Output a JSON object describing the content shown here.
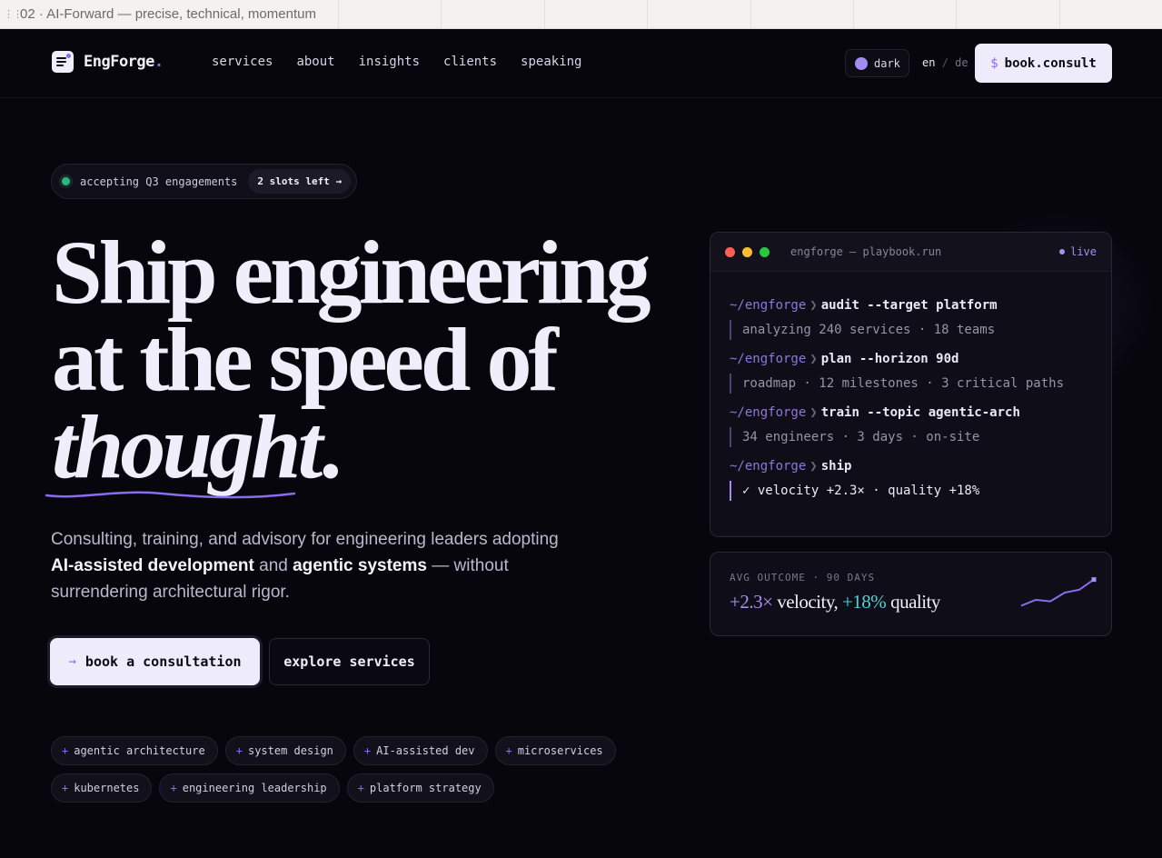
{
  "frame_label": "02 · AI-Forward — precise, technical, momentum",
  "brand": {
    "name": "EngForge",
    "accent_char": ".",
    "accent_color": "#8b6cf0"
  },
  "nav": {
    "links": [
      "services",
      "about",
      "insights",
      "clients",
      "speaking"
    ],
    "theme_label": "dark",
    "lang_active": "en",
    "lang_sep": "/",
    "lang_other": "de",
    "cta_sign": "$",
    "cta_label": "book.consult"
  },
  "hero": {
    "status_text": "accepting Q3 engagements",
    "slots_label": "2 slots left →",
    "headline_1": "Ship engineering",
    "headline_2": "at the speed of",
    "headline_3": "thought",
    "headline_period": ".",
    "sub_1": "Consulting, training, and advisory for engineering leaders adopting ",
    "sub_b1": "AI-assisted development",
    "sub_2": " and ",
    "sub_b2": "agentic systems",
    "sub_3": " — without surrendering architectural rigor.",
    "cta_primary_arrow": "→",
    "cta_primary": "book a consultation",
    "cta_secondary": "explore services",
    "tags": [
      [
        "agentic architecture",
        "system design",
        "AI-assisted dev",
        "microservices"
      ],
      [
        "kubernetes",
        "engineering leadership",
        "platform strategy"
      ]
    ],
    "tag_prefix": "+"
  },
  "terminal": {
    "title": "engforge — playbook.run",
    "live": "live",
    "prompt": "~/engforge",
    "chevron": "❯",
    "commands": [
      {
        "cmd": "audit --target platform",
        "out": "analyzing 240 services · 18 teams"
      },
      {
        "cmd": "plan --horizon 90d",
        "out": "roadmap · 12 milestones · 3 critical paths"
      },
      {
        "cmd": "train --topic agentic-arch",
        "out": "34 engineers · 3 days · on-site"
      },
      {
        "cmd": "ship",
        "out": "✓ velocity +2.3× · quality +18%"
      }
    ]
  },
  "outcome": {
    "label": "AVG OUTCOME · 90 DAYS",
    "velocity_value": "+2.3×",
    "velocity_word": " velocity, ",
    "quality_value": "+18%",
    "quality_word": " quality",
    "sparkline": [
      0.05,
      0.25,
      0.2,
      0.5,
      0.6,
      0.95
    ]
  },
  "colors": {
    "background": "#07060d",
    "accent": "#8b6cf0",
    "teal": "#4fd2d6",
    "status_green": "#2fb67d",
    "traffic": [
      "#ff5f57",
      "#febc2e",
      "#28c840"
    ]
  },
  "icons": {
    "logo": "document-lines-icon",
    "theme": "circle-toggle-icon"
  }
}
